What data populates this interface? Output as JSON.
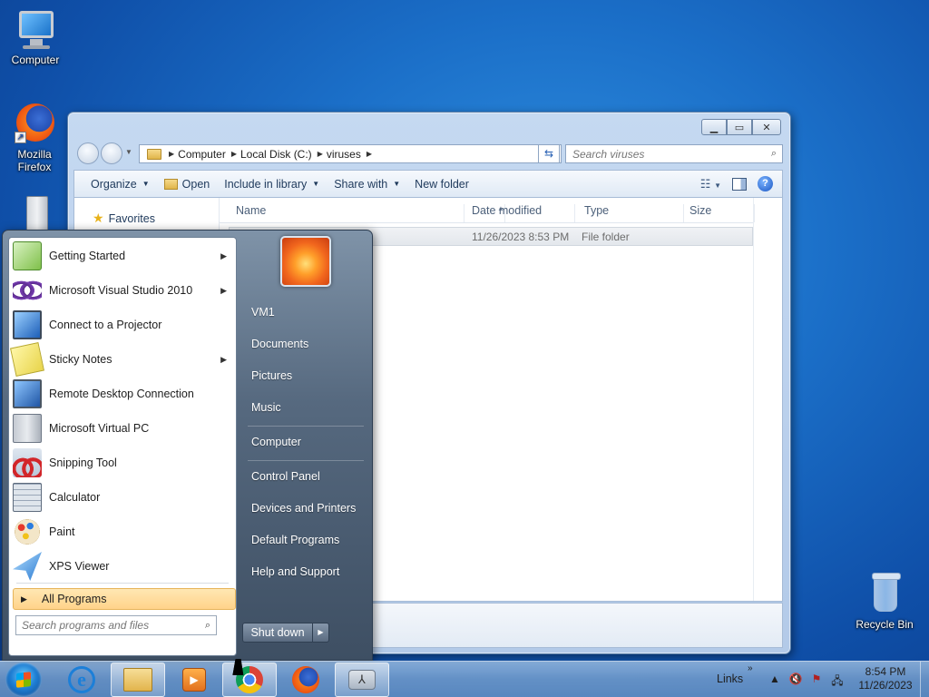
{
  "desktop": {
    "icons": [
      {
        "label": "Computer",
        "icon": "computer-icon"
      },
      {
        "label": "Mozilla Firefox",
        "icon": "firefox-icon"
      },
      {
        "label": "Recycle Bin",
        "icon": "recycle-bin-icon"
      }
    ]
  },
  "explorer": {
    "breadcrumb": [
      "Computer",
      "Local Disk (C:)",
      "viruses"
    ],
    "search_placeholder": "Search viruses",
    "toolbar": {
      "organize": "Organize",
      "open": "Open",
      "include_in_library": "Include in library",
      "share_with": "Share with",
      "new_folder": "New folder"
    },
    "nav": {
      "favorites": "Favorites"
    },
    "columns": {
      "name": "Name",
      "date_modified": "Date modified",
      "type": "Type",
      "size": "Size"
    },
    "rows": [
      {
        "name": "",
        "date_modified": "11/26/2023 8:53 PM",
        "type": "File folder",
        "size": ""
      }
    ]
  },
  "start_menu": {
    "programs": [
      {
        "label": "Getting Started",
        "icon": "getting-started-icon",
        "submenu": true
      },
      {
        "label": "Microsoft Visual Studio 2010",
        "icon": "visual-studio-icon",
        "submenu": true
      },
      {
        "label": "Connect to a Projector",
        "icon": "projector-icon",
        "submenu": false
      },
      {
        "label": "Sticky Notes",
        "icon": "sticky-notes-icon",
        "submenu": true
      },
      {
        "label": "Remote Desktop Connection",
        "icon": "remote-desktop-icon",
        "submenu": false
      },
      {
        "label": "Microsoft Virtual PC",
        "icon": "virtual-pc-icon",
        "submenu": false
      },
      {
        "label": "Snipping Tool",
        "icon": "snipping-tool-icon",
        "submenu": false
      },
      {
        "label": "Calculator",
        "icon": "calculator-icon",
        "submenu": false
      },
      {
        "label": "Paint",
        "icon": "paint-icon",
        "submenu": false
      },
      {
        "label": "XPS Viewer",
        "icon": "xps-viewer-icon",
        "submenu": false
      }
    ],
    "all_programs": "All Programs",
    "search_placeholder": "Search programs and files",
    "right_links": [
      "VM1",
      "Documents",
      "Pictures",
      "Music",
      "Computer",
      "Control Panel",
      "Devices and Printers",
      "Default Programs",
      "Help and Support"
    ],
    "shutdown": "Shut down"
  },
  "taskbar": {
    "pinned": [
      {
        "name": "internet-explorer-icon"
      },
      {
        "name": "windows-explorer-icon"
      },
      {
        "name": "media-player-icon"
      },
      {
        "name": "chrome-icon"
      },
      {
        "name": "firefox-icon"
      },
      {
        "name": "visual-studio-icon"
      }
    ],
    "links": "Links",
    "clock": {
      "time": "8:54 PM",
      "date": "11/26/2023"
    }
  },
  "colors": {
    "desktop": "#1b6fc8",
    "start_menu": "#56697f",
    "all_programs_highlight": "#ffd38a"
  }
}
